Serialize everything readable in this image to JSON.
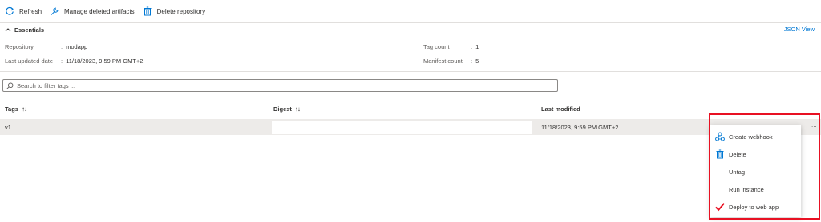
{
  "toolbar": {
    "refresh_label": "Refresh",
    "manage_deleted_label": "Manage deleted artifacts",
    "delete_repo_label": "Delete repository"
  },
  "essentials": {
    "title": "Essentials",
    "json_view_label": "JSON View",
    "repository_label": "Repository",
    "repository_value": "modapp",
    "last_updated_label": "Last updated date",
    "last_updated_value": "11/18/2023, 9:59 PM GMT+2",
    "tag_count_label": "Tag count",
    "tag_count_value": "1",
    "manifest_count_label": "Manifest count",
    "manifest_count_value": "5"
  },
  "search": {
    "placeholder": "Search to filter tags ..."
  },
  "table": {
    "columns": [
      {
        "label": "Tags",
        "sort": "↑↓"
      },
      {
        "label": "Digest",
        "sort": "↑↓"
      },
      {
        "label": "Last modified",
        "sort": ""
      }
    ],
    "rows": [
      {
        "tag": "v1",
        "digest": "",
        "last_modified": "11/18/2023, 9:59 PM GMT+2",
        "more": "..."
      }
    ]
  },
  "context_menu": {
    "items": [
      {
        "label": "Create webhook",
        "icon": "webhook-icon"
      },
      {
        "label": "Delete",
        "icon": "trash-icon"
      },
      {
        "label": "Untag",
        "icon": ""
      },
      {
        "label": "Run instance",
        "icon": ""
      },
      {
        "label": "Deploy to web app",
        "icon": "checkmark-icon"
      }
    ]
  },
  "colors": {
    "accent": "#0078d4",
    "highlight": "#e81123",
    "row_selected": "#edebe9"
  }
}
